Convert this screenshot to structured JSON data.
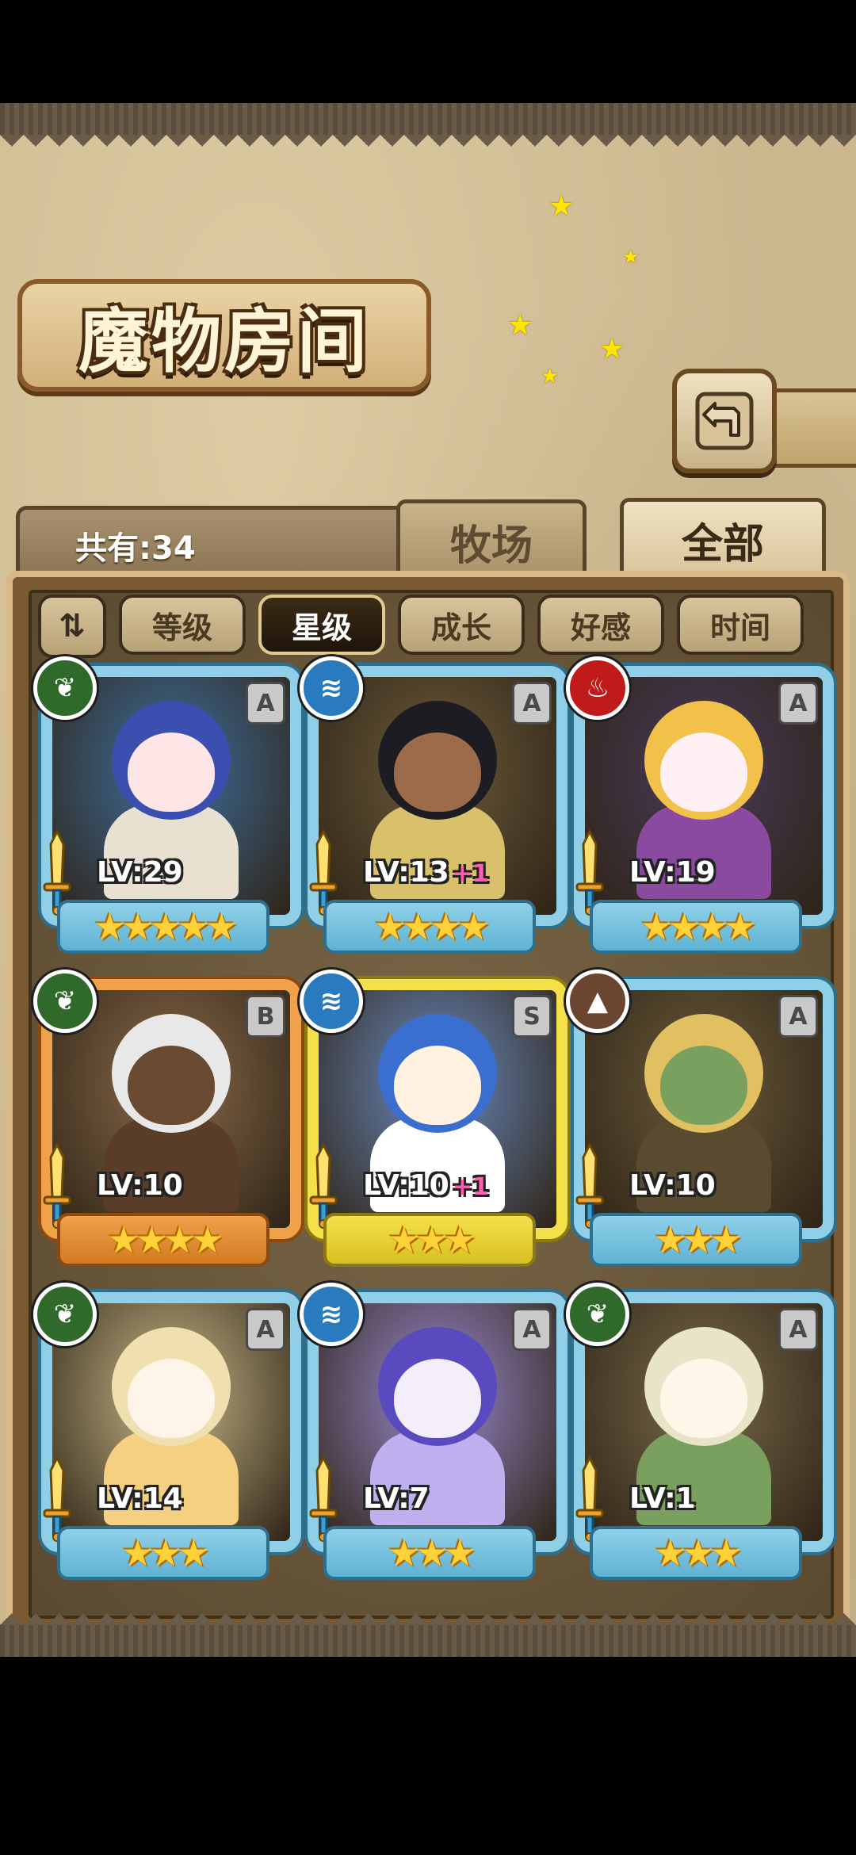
{
  "title": "魔物房间",
  "count_label": "共有:34",
  "tabs": {
    "farm": "牧场",
    "all": "全部"
  },
  "sort": {
    "toggle_icon": "sort-toggle-icon",
    "buttons": [
      "等级",
      "星级",
      "成长",
      "好感",
      "时间"
    ],
    "active_index": 1
  },
  "monsters": [
    {
      "element": "grass",
      "rank": "A",
      "level": "LV:29",
      "plus": "",
      "stars": 5,
      "hair": "#3b4fb0",
      "skin": "#ffe6e6",
      "body": "#e8e0d0",
      "bg": "#3f6fa0"
    },
    {
      "element": "water",
      "rank": "A",
      "level": "LV:13",
      "plus": "+1",
      "stars": 4,
      "hair": "#1c1c22",
      "skin": "#9b6b4a",
      "body": "#d9c06a",
      "bg": "#6b5a3a"
    },
    {
      "element": "fire",
      "rank": "A",
      "level": "LV:19",
      "plus": "",
      "stars": 4,
      "hair": "#f2c14a",
      "skin": "#fff0f4",
      "body": "#8a4aa0",
      "bg": "#4a3a5a"
    },
    {
      "element": "grass",
      "rank": "B",
      "level": "LV:10",
      "plus": "",
      "stars": 4,
      "hair": "#e8e8e8",
      "skin": "#6b4a32",
      "body": "#5a3d28",
      "bg": "#8a6a4a"
    },
    {
      "element": "water",
      "rank": "S",
      "level": "LV:10",
      "plus": "+1",
      "stars": 3,
      "hair": "#3a6fd0",
      "skin": "#fff2e0",
      "body": "#ffffff",
      "bg": "#6a8ac0"
    },
    {
      "element": "earth",
      "rank": "A",
      "level": "LV:10",
      "plus": "",
      "stars": 3,
      "hair": "#e0c060",
      "skin": "#7aa060",
      "body": "#5a4a30",
      "bg": "#6b5a3a"
    },
    {
      "element": "grass",
      "rank": "A",
      "level": "LV:14",
      "plus": "",
      "stars": 3,
      "hair": "#f0e0b0",
      "skin": "#fff4e8",
      "body": "#f4d080",
      "bg": "#c8b888"
    },
    {
      "element": "water",
      "rank": "A",
      "level": "LV:7",
      "plus": "",
      "stars": 3,
      "hair": "#5a4ac0",
      "skin": "#f4eefa",
      "body": "#c0b0f0",
      "bg": "#9a8ad0"
    },
    {
      "element": "grass",
      "rank": "A",
      "level": "LV:1",
      "plus": "",
      "stars": 3,
      "hair": "#e8e4c8",
      "skin": "#fff6ea",
      "body": "#7aa060",
      "bg": "#7a6a4a"
    }
  ],
  "colors": {
    "grass": "#2f6a2a",
    "water": "#2a7ac0",
    "fire": "#c01a1a",
    "earth": "#6a4630"
  }
}
